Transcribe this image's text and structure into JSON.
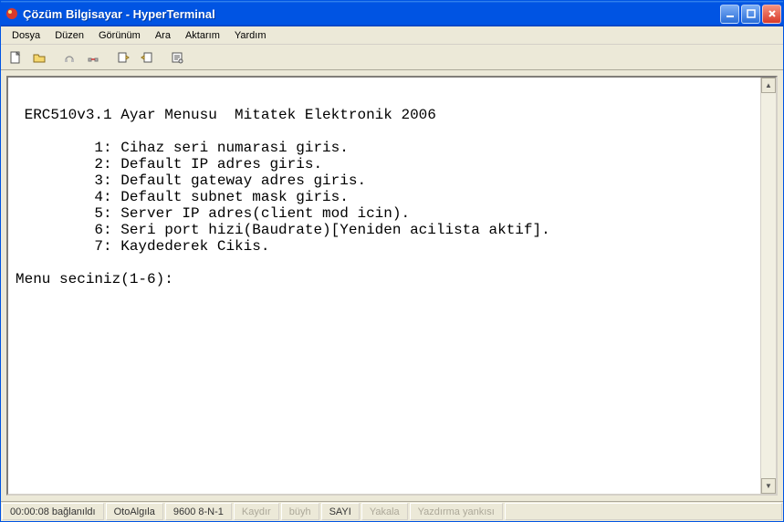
{
  "window": {
    "title": "Çözüm Bilgisayar - HyperTerminal"
  },
  "menu": {
    "file": "Dosya",
    "edit": "Düzen",
    "view": "Görünüm",
    "search": "Ara",
    "transfer": "Aktarım",
    "help": "Yardım"
  },
  "terminal": {
    "header": " ERC510v3.1 Ayar Menusu  Mitatek Elektronik 2006",
    "item1": "         1: Cihaz seri numarasi giris.",
    "item2": "         2: Default IP adres giris.",
    "item3": "         3: Default gateway adres giris.",
    "item4": "         4: Default subnet mask giris.",
    "item5": "         5: Server IP adres(client mod icin).",
    "item6": "         6: Seri port hizi(Baudrate)[Yeniden acilista aktif].",
    "item7": "         7: Kaydederek Cikis.",
    "prompt": "Menu seciniz(1-6):"
  },
  "status": {
    "time": "00:00:08",
    "conn": "bağlanıldı",
    "detect": "OtoAlgıla",
    "port": "9600 8-N-1",
    "scroll": "Kaydır",
    "caps": "büyh",
    "num": "SAYI",
    "capture": "Yakala",
    "echo": "Yazdırma yankısı"
  }
}
